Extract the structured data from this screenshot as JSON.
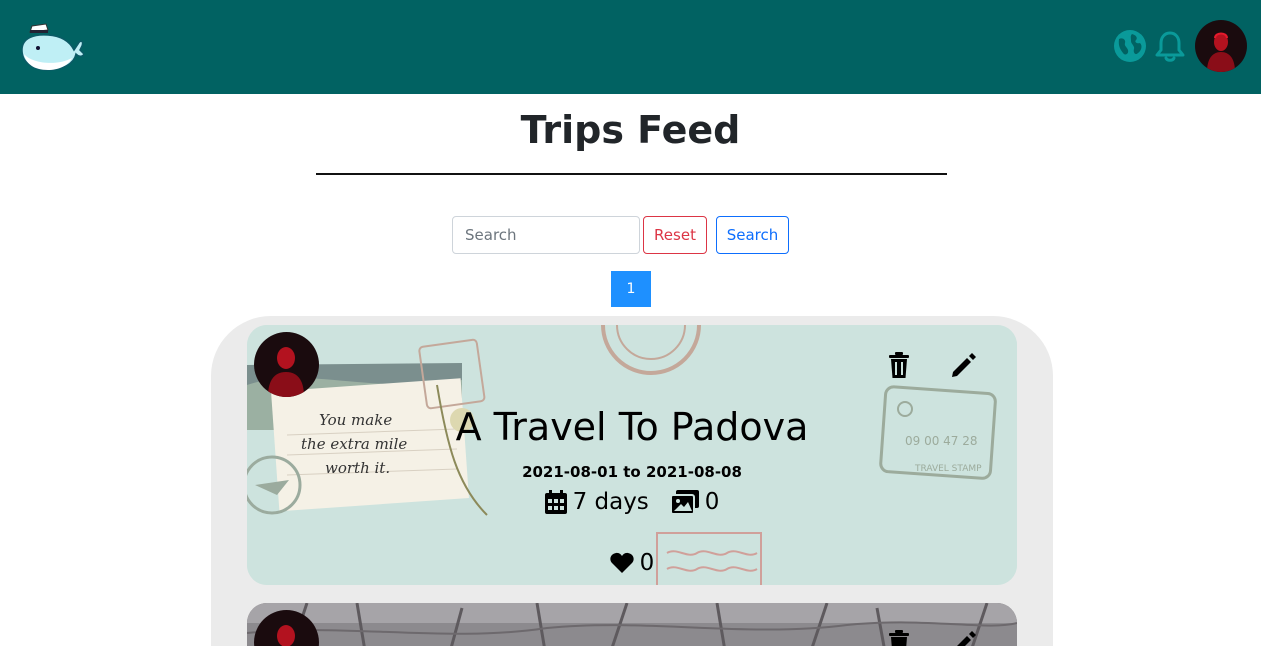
{
  "header": {
    "logo_icon": "whale-logo-icon",
    "globe_icon": "globe-icon",
    "bell_icon": "bell-icon",
    "colors": {
      "bar": "#016262",
      "icon": "#0a9a9a"
    }
  },
  "page": {
    "title": "Trips Feed"
  },
  "search": {
    "placeholder": "Search",
    "value": "",
    "reset_label": "Reset",
    "search_label": "Search"
  },
  "pagination": {
    "pages": [
      "1"
    ],
    "current": "1"
  },
  "trips": [
    {
      "title": "A Travel To Padova",
      "start_date": "2021-08-01",
      "date_separator": "to",
      "end_date": "2021-08-08",
      "duration": "7 days",
      "photos": "0",
      "likes": "0",
      "background_text": [
        "You make",
        "the extra mile",
        "worth it.",
        "09 00 47 28",
        "TRAVEL STAMP"
      ]
    }
  ]
}
